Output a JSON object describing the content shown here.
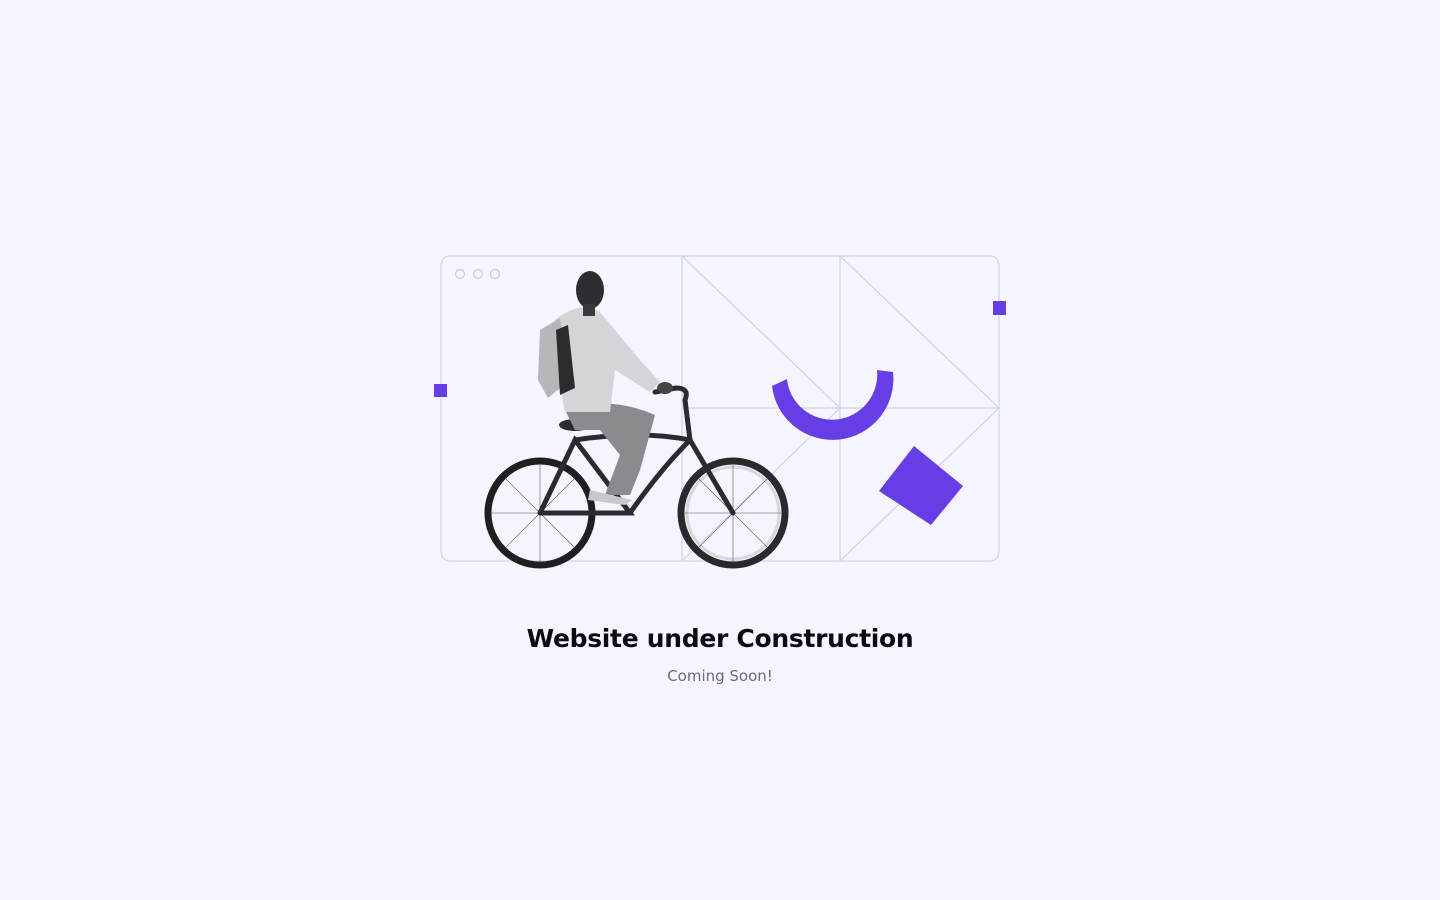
{
  "page": {
    "title": "Website under Construction",
    "subtitle": "Coming Soon!"
  },
  "colors": {
    "background": "#f5f5ff",
    "accent": "#673de6",
    "frame_lines": "#cdd3f0",
    "title": "#0b0b0f",
    "subtitle": "#6b6b78"
  },
  "illustration": {
    "subject": "person-riding-bicycle",
    "icons": [
      "browser-window-dots-icon",
      "semicircle-arc-shape",
      "diamond-shape",
      "square-shape"
    ]
  }
}
